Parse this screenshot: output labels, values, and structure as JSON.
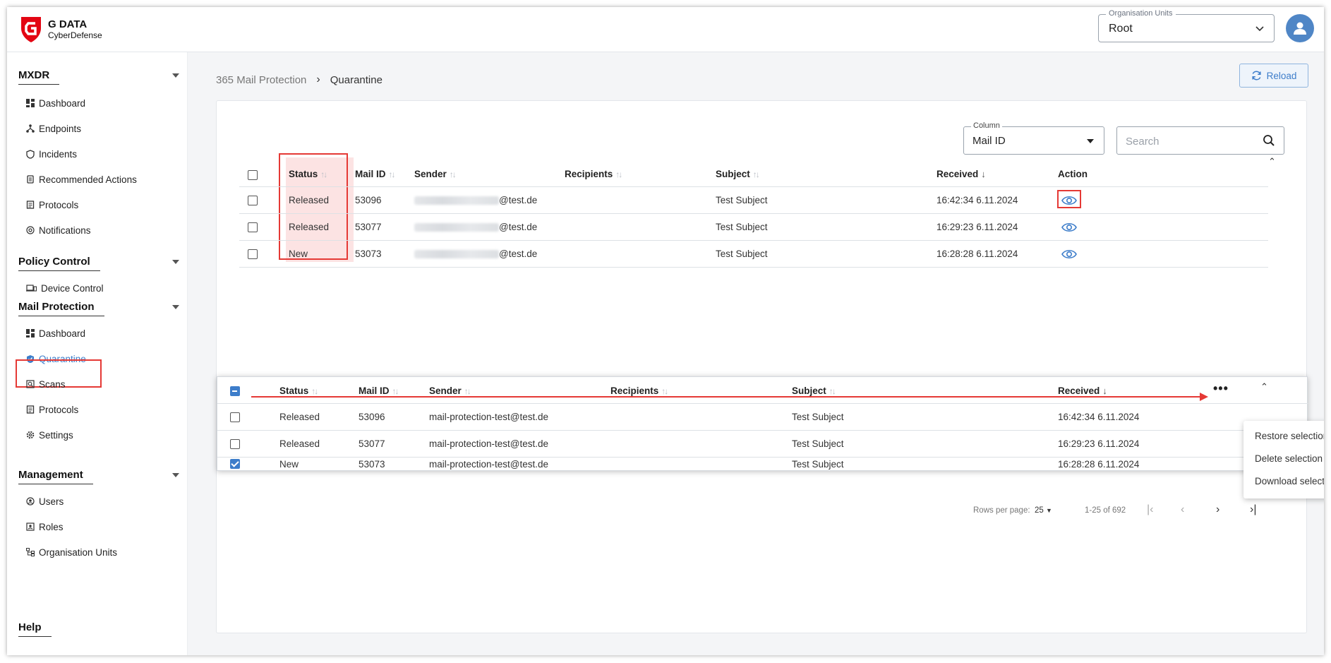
{
  "brand": {
    "name": "G DATA",
    "sub": "CyberDefense"
  },
  "org_units": {
    "label": "Organisation Units",
    "value": "Root"
  },
  "sidebar": {
    "sections": [
      {
        "title": "MXDR",
        "items": [
          "Dashboard",
          "Endpoints",
          "Incidents",
          "Recommended Actions",
          "Protocols",
          "Notifications"
        ]
      },
      {
        "title": "Policy Control",
        "items": [
          "Device Control"
        ]
      },
      {
        "title": "Mail Protection",
        "items": [
          "Dashboard",
          "Quarantine",
          "Scans",
          "Protocols",
          "Settings"
        ]
      },
      {
        "title": "Management",
        "items": [
          "Users",
          "Roles",
          "Organisation Units"
        ]
      }
    ],
    "help": "Help",
    "active": "Quarantine"
  },
  "breadcrumb": {
    "parent": "365 Mail Protection",
    "current": "Quarantine"
  },
  "reload_label": "Reload",
  "filter": {
    "column_label": "Column",
    "column_value": "Mail ID",
    "search_placeholder": "Search"
  },
  "table": {
    "headers": {
      "status": "Status",
      "mail_id": "Mail ID",
      "sender": "Sender",
      "recipients": "Recipients",
      "subject": "Subject",
      "received": "Received",
      "action": "Action"
    },
    "rows": [
      {
        "status": "Released",
        "mail_id": "53096",
        "sender_domain": "@test.de",
        "subject": "Test Subject",
        "received": "16:42:34 6.11.2024"
      },
      {
        "status": "Released",
        "mail_id": "53077",
        "sender_domain": "@test.de",
        "subject": "Test Subject",
        "received": "16:29:23 6.11.2024"
      },
      {
        "status": "New",
        "mail_id": "53073",
        "sender_domain": "@test.de",
        "subject": "Test Subject",
        "received": "16:28:28 6.11.2024"
      }
    ]
  },
  "selection_table": {
    "rows": [
      {
        "status": "Released",
        "mail_id": "53096",
        "sender": "mail-protection-test@test.de",
        "subject": "Test Subject",
        "received": "16:42:34 6.11.2024",
        "checked": false
      },
      {
        "status": "Released",
        "mail_id": "53077",
        "sender": "mail-protection-test@test.de",
        "subject": "Test Subject",
        "received": "16:29:23 6.11.2024",
        "checked": false
      },
      {
        "status": "New",
        "mail_id": "53073",
        "sender": "mail-protection-test@test.de",
        "subject": "Test Subject",
        "received": "16:28:28 6.11.2024",
        "checked": true
      }
    ],
    "menu": [
      "Restore selection",
      "Delete selection",
      "Download selection"
    ]
  },
  "pager": {
    "rows_label": "Rows per page:",
    "rows_value": "25",
    "range": "1-25 of 692"
  },
  "colors": {
    "accent": "#3d7dca",
    "highlight": "#e53935",
    "brand_red": "#e30613"
  }
}
